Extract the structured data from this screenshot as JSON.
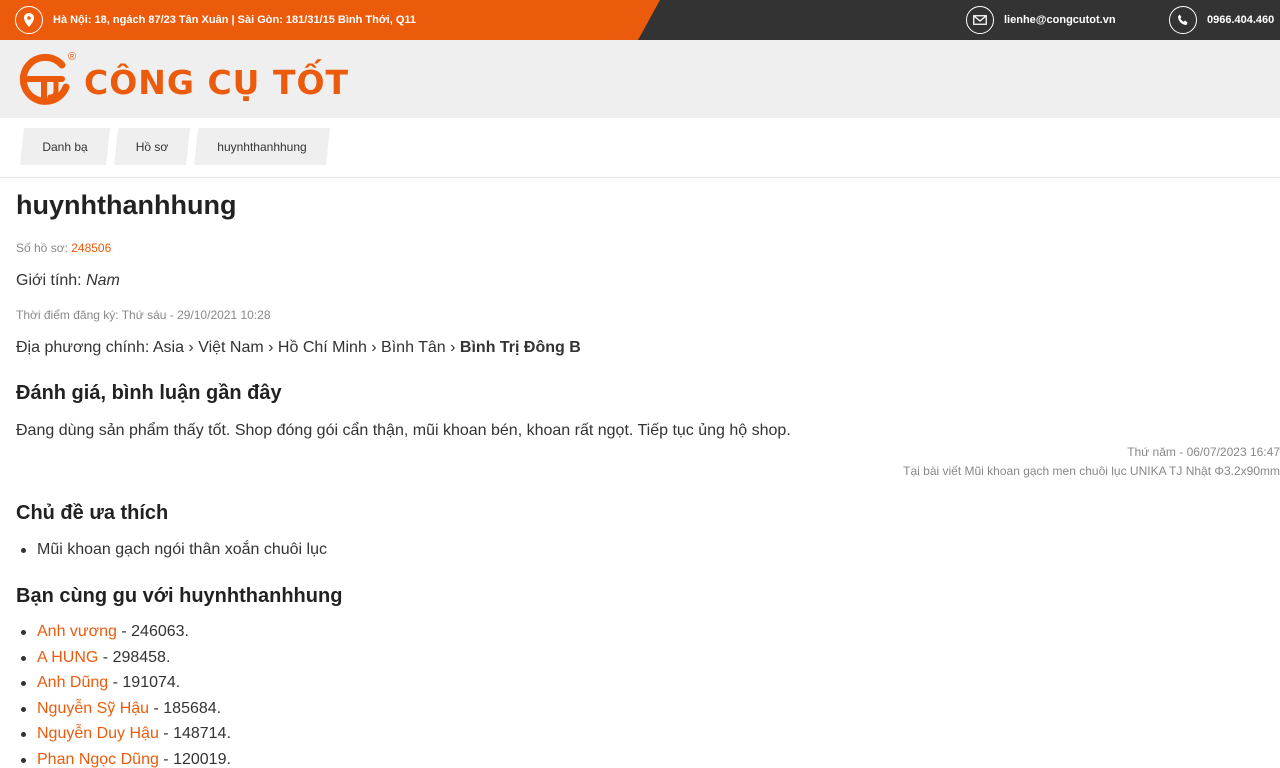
{
  "topbar": {
    "address": "Hà Nội: 18, ngách 87/23 Tân Xuân | Sài Gòn: 181/31/15 Bình Thới, Q11",
    "email": "lienhe@congcutot.vn",
    "phone": "0966.404.460",
    "icons": [
      "location-icon",
      "mail-icon",
      "phone-icon"
    ]
  },
  "logo": {
    "text": "CÔNG CỤ TỐT",
    "registered": "®"
  },
  "breadcrumb": [
    "Danh bạ",
    "Hồ sơ",
    "huynhthanhhung"
  ],
  "profile": {
    "name": "huynhthanhhung",
    "id_label": "Số hồ sơ: ",
    "id_value": "248506",
    "gender_label": "Giới tính: ",
    "gender_value": "Nam",
    "registered": "Thời điểm đăng ký: Thứ sáu - 29/10/2021 10:28",
    "location_label": "Địa phương chính: ",
    "location_path": "Asia › Việt Nam › Hồ Chí Minh › Bình Tân › ",
    "location_last": "Bình Trị Đông B"
  },
  "reviews": {
    "heading": "Đánh giá, bình luận gần đây",
    "text": "Đang dùng sản phẩm thấy tốt. Shop đóng gói cẩn thận, mũi khoan bén, khoan rất ngọt. Tiếp tục ủng hộ shop.",
    "date": "Thứ năm - 06/07/2023 16:47",
    "source": "Tại bài viết Mũi khoan gạch men chuôi lục UNIKA TJ Nhật Φ3.2x90mm"
  },
  "topics": {
    "heading": "Chủ đề ưa thích",
    "items": [
      "Mũi khoan gạch ngói thân xoắn chuôi lục"
    ]
  },
  "friends": {
    "heading": "Bạn cùng gu với huynhthanhhung",
    "items": [
      {
        "name": "Anh vương",
        "suffix": " - 246063."
      },
      {
        "name": "A HUNG",
        "suffix": " - 298458."
      },
      {
        "name": "Anh Dũng",
        "suffix": " - 191074."
      },
      {
        "name": "Nguyễn Sỹ Hậu",
        "suffix": " - 185684."
      },
      {
        "name": "Nguyễn Duy Hậu",
        "suffix": " - 148714."
      },
      {
        "name": "Phan Ngọc Dũng",
        "suffix": " - 120019."
      }
    ]
  },
  "colors": {
    "accent": "#ec5b0c",
    "dark": "#333333",
    "light": "#efefef"
  }
}
